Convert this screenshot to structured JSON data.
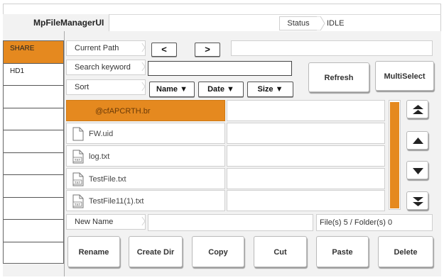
{
  "app": {
    "title": "MpFileManagerUI"
  },
  "status": {
    "label": "Status",
    "value": "IDLE"
  },
  "drives": [
    {
      "label": "SHARE",
      "active": true
    },
    {
      "label": "HD1",
      "active": false
    },
    {
      "label": "",
      "active": false
    },
    {
      "label": "",
      "active": false
    },
    {
      "label": "",
      "active": false
    },
    {
      "label": "",
      "active": false
    },
    {
      "label": "",
      "active": false
    },
    {
      "label": "",
      "active": false
    },
    {
      "label": "",
      "active": false
    },
    {
      "label": "",
      "active": false
    }
  ],
  "current_path": {
    "label": "Current Path",
    "value": "",
    "back_label": "<",
    "forward_label": ">"
  },
  "search": {
    "label": "Search keyword",
    "value": ""
  },
  "sort": {
    "label": "Sort",
    "name_label": "Name ▼",
    "date_label": "Date ▼",
    "size_label": "Size ▼"
  },
  "actions": {
    "refresh": "Refresh",
    "multiselect": "MultiSelect"
  },
  "files": [
    {
      "name": "@cfAPCRTH.br",
      "icon": "none",
      "selected": true
    },
    {
      "name": "FW.uid",
      "icon": "blank-file-icon",
      "selected": false
    },
    {
      "name": "log.txt",
      "icon": "txt-file-icon",
      "selected": false
    },
    {
      "name": "TestFile.txt",
      "icon": "txt-file-icon",
      "selected": false
    },
    {
      "name": "TestFile11(1).txt",
      "icon": "txt-file-icon",
      "selected": false
    }
  ],
  "icon_badge_text": "TXT",
  "new_name": {
    "label": "New Name",
    "value": ""
  },
  "counts": "File(s) 5 / Folder(s) 0",
  "bottom_buttons": {
    "rename": "Rename",
    "create_dir": "Create Dir",
    "copy": "Copy",
    "cut": "Cut",
    "paste": "Paste",
    "delete": "Delete"
  },
  "colors": {
    "accent": "#e5891f",
    "panel": "#f2f2f2",
    "border": "#cfcfcf"
  }
}
